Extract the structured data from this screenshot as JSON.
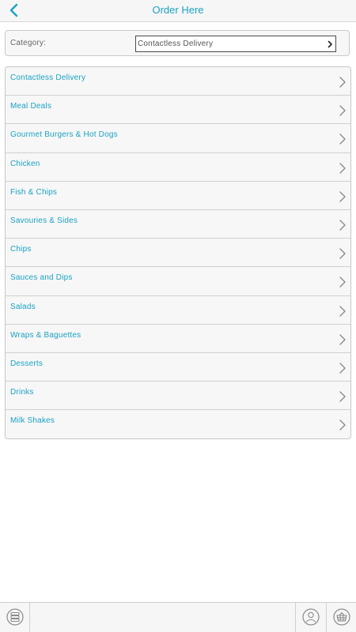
{
  "header": {
    "title": "Order Here",
    "back_icon": "chevron-left-icon"
  },
  "category": {
    "label": "Category:",
    "selected": "Contactless Delivery"
  },
  "menu": {
    "items": [
      {
        "label": "Contactless Delivery"
      },
      {
        "label": "Meal Deals"
      },
      {
        "label": "Gourmet Burgers & Hot Dogs"
      },
      {
        "label": "Chicken"
      },
      {
        "label": "Fish & Chips"
      },
      {
        "label": "Savouries & Sides"
      },
      {
        "label": "Chips"
      },
      {
        "label": "Sauces and Dips"
      },
      {
        "label": "Salads"
      },
      {
        "label": "Wraps & Baguettes"
      },
      {
        "label": "Desserts"
      },
      {
        "label": "Drinks"
      },
      {
        "label": "Milk Shakes"
      }
    ]
  },
  "toolbar": {
    "menu_icon": "list-menu-icon",
    "account_icon": "user-account-icon",
    "basket_icon": "basket-icon"
  },
  "colors": {
    "accent": "#1aa2c4",
    "chevron": "#8a8a8a",
    "border": "#c8c8c8"
  }
}
